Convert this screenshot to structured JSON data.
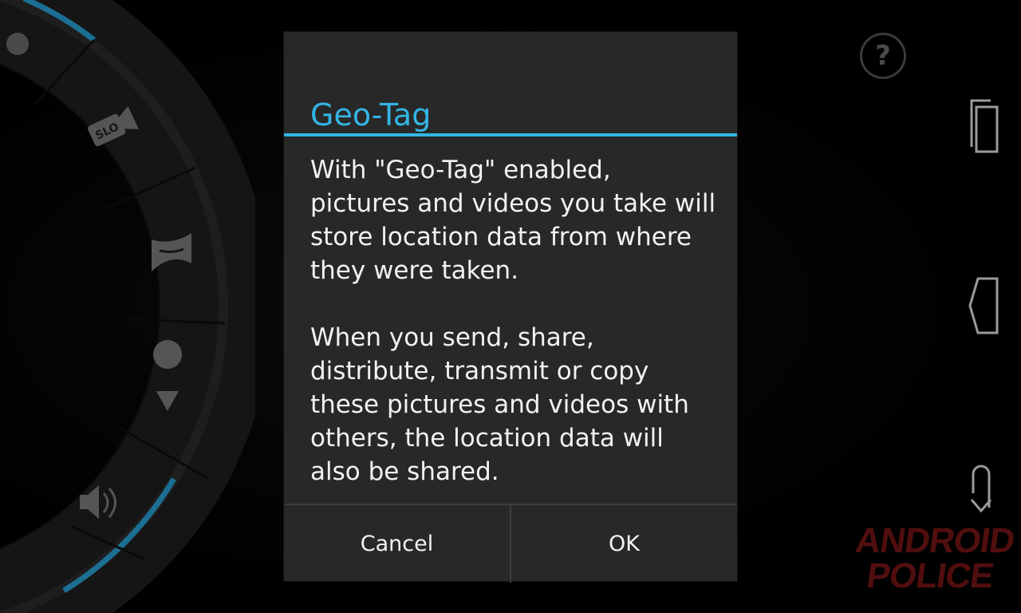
{
  "dialog": {
    "title": "Geo-Tag",
    "body_paragraph_1": "With \"Geo-Tag\" enabled, pictures and videos you take will store location data from where they were taken.",
    "body_paragraph_2": "When you send, share, distribute, transmit or copy these pictures and videos with others, the location data will also be shared.",
    "cancel_label": "Cancel",
    "ok_label": "OK"
  },
  "camera_controls": {
    "help_label": "?",
    "wheel_items": [
      "slow-motion-icon",
      "panorama-icon",
      "location-pin-icon",
      "sound-icon"
    ]
  },
  "watermark": {
    "line1": "ANDROID",
    "line2": "POLICE"
  },
  "colors": {
    "accent": "#33b5e5",
    "dialog_bg": "#282828",
    "text": "#f2f2f2"
  }
}
